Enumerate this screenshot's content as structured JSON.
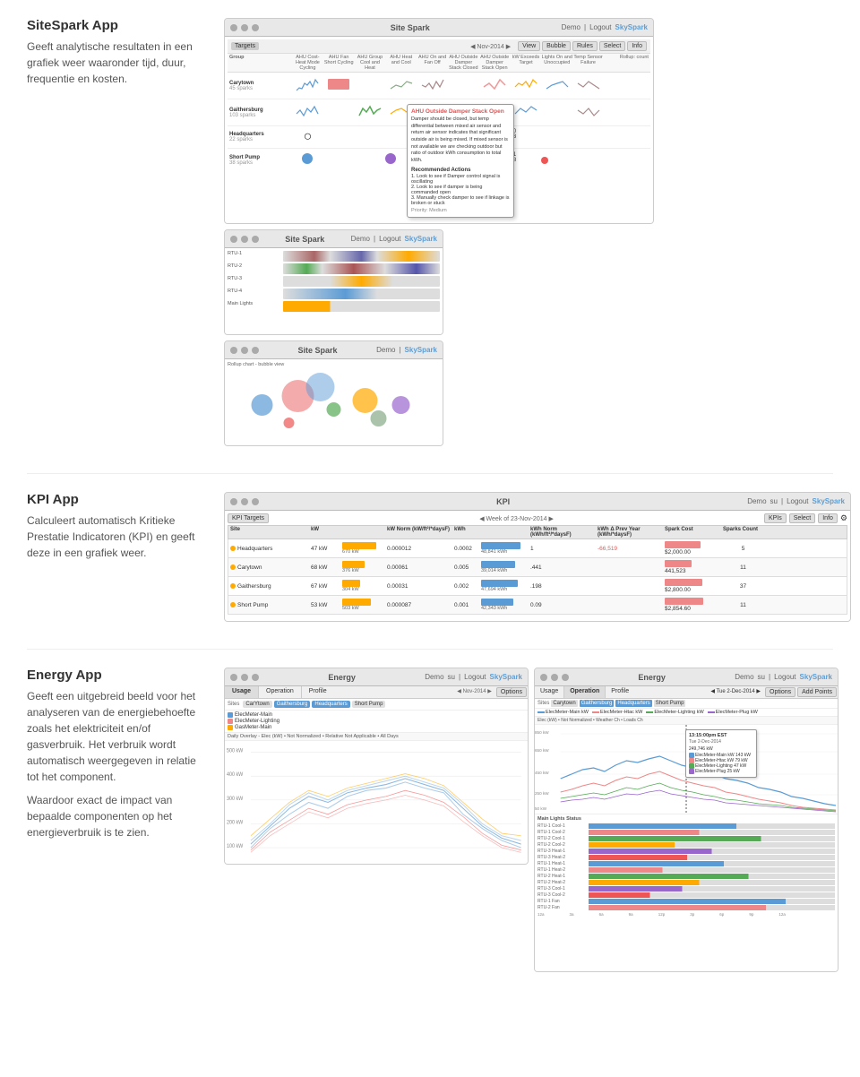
{
  "sections": {
    "sitespark": {
      "title": "SiteSpark App",
      "body": "Geeft analytische resultaten in een grafiek weer waaronder tijd, duur, frequentie en kosten.",
      "app_title": "Site Spark",
      "nav_items": [
        "Targets"
      ],
      "toolbar_right": [
        "View",
        "Bubble",
        "Rules",
        "Select",
        "Info"
      ],
      "date": "Nov-2014",
      "table_headers": [
        "Group",
        "AHU Cost-Heat Mode Cycling",
        "AHU Fan Short Cycling",
        "AHU Group Cool and Heat",
        "AHU Heat and Cool",
        "AHU On and Fan Off",
        "AHU Outside Damper Stack Closed",
        "AHU Outside Damper Stack Open",
        "kW Exceeds Target",
        "Lights On and Unoccupied",
        "Temp Sensor Failure"
      ],
      "groups": [
        {
          "name": "Carytown",
          "sparks": "45 sparks"
        },
        {
          "name": "Gaithersburg",
          "sparks": "103 sparks"
        },
        {
          "name": "Headquarters",
          "sparks": "22 sparks"
        },
        {
          "name": "Short Pump",
          "sparks": "38 sparks"
        }
      ],
      "tooltip": {
        "title": "AHU Outside Damper Stack Open",
        "body": "Damper should be closed, but temp differential between mixed air sensor and return air sensor indicates that significant outside air is being mixed. If mixed sensor is not available we are checking outdoor but ratio of outdoor kWh consumption to total kWh.",
        "actions": "Recommended Actions",
        "action1": "1. Look to see if Damper control signal is oscillating",
        "action2": "2. Look to see if damper is being commanded open",
        "action3": "3. Manually check damper to see if linkage is broken or stuck",
        "priority": "Priority: Medium"
      }
    },
    "kpi": {
      "title": "KPI App",
      "body": "Calculeert automatisch Kritieke Prestatie Indicatoren (KPI) en geeft deze in een grafiek weer.",
      "app_title": "KPI",
      "nav_items": [
        "KPI Targets"
      ],
      "toolbar_right": [
        "KPIs",
        "Select",
        "Info"
      ],
      "date": "Week of 23-Nov-2014",
      "columns": [
        "Site",
        "kW",
        "",
        "kW Norm (kW/ft²/*daysF)",
        "kWh",
        "",
        "kWh Norm (kWh/ft²/*daysF)",
        "kWh Δ Prev Year (kWh/*daysF)",
        "Spark Cost",
        "Sparks Count"
      ],
      "rows": [
        {
          "site": "Headquarters",
          "indicator": "orange",
          "kw": "47 kW",
          "kw_bar_val": 670,
          "kw_norm": "0.000012",
          "kwh": "0.0002",
          "kwh_bar_val": 48841,
          "kwh_label": "48,841 kWh",
          "kwh_norm": "1",
          "kwh_prev": "-66,519",
          "spark_cost": "$2,000.00",
          "sparks": "5"
        },
        {
          "site": "Carytown",
          "indicator": "orange",
          "kw": "68 kW",
          "kw_bar_val": 376,
          "kw_norm": "0.00061",
          "kwh": "0.005",
          "kwh_bar_val": 39014,
          "kwh_label": "39,014 kWh",
          "kwh_norm": ".441",
          "kwh_prev": "",
          "spark_cost": "441,523",
          "sparks": "11"
        },
        {
          "site": "Gaithersburg",
          "indicator": "orange",
          "kw": "67 kW",
          "kw_bar_val": 304,
          "kw_norm": "0.00031",
          "kwh": "0.002",
          "kwh_bar_val": 47694,
          "kwh_label": "47,694 kWh",
          "kwh_norm": ".198",
          "kwh_prev": "",
          "spark_cost": "$2,800.00",
          "sparks": "37"
        },
        {
          "site": "Short Pump",
          "indicator": "orange",
          "kw": "53 kW",
          "kw_bar_val": 503,
          "kw_norm": "0.000087",
          "kwh": "0.001",
          "kwh_bar_val": 42343,
          "kwh_label": "42,343 kWh",
          "kwh_norm": "0.09",
          "kwh_prev": "",
          "spark_cost": "$2,854.60",
          "sparks": "11"
        }
      ]
    },
    "energy": {
      "title": "Energy App",
      "body1": "Geeft een uitgebreid beeld voor het analyseren van de energiebehoefte zoals het elektriciteit en/of gasverbruik. Het verbruik wordt automatisch weergegeven in relatie tot het component.",
      "body2": "Waardoor exact de impact van bepaalde componenten op het energieverbruik is te zien.",
      "app_title": "Energy",
      "nav_items": [
        "Usage",
        "Operation",
        "Profile"
      ],
      "date": "Nov-2014",
      "toolbar_right": [
        "Options"
      ],
      "sites": [
        "CarYtown",
        "Gaithersburg",
        "Headquarters",
        "Short Pump"
      ],
      "meters": [
        "ElecMeter-Main",
        "ElecMeter-Lighting",
        "GasMeter-Main"
      ],
      "overlay_label": "Daily Overlay - Elec (kW) • Not Normalized • Relative Not Applicable • All Days",
      "detail": {
        "date": "Tue 2-Dec-2014",
        "toolbar_right": [
          "Options",
          "Add Points"
        ],
        "tooltip_time": "13:15:00pm EST",
        "tooltip_date": "Tue 2-Dec-2014",
        "tooltip_kw": "249,746 kW",
        "meters_detail": [
          {
            "name": "ElecMeter-Main kW",
            "val": "143 kW"
          },
          {
            "name": "ElecMeter-Htac kW",
            "val": "79 kW"
          },
          {
            "name": "ElecMeter-Lighting kW",
            "val": "47 kW"
          },
          {
            "name": "ElecMeter-Plug kW",
            "val": "25 kW"
          }
        ]
      }
    }
  }
}
